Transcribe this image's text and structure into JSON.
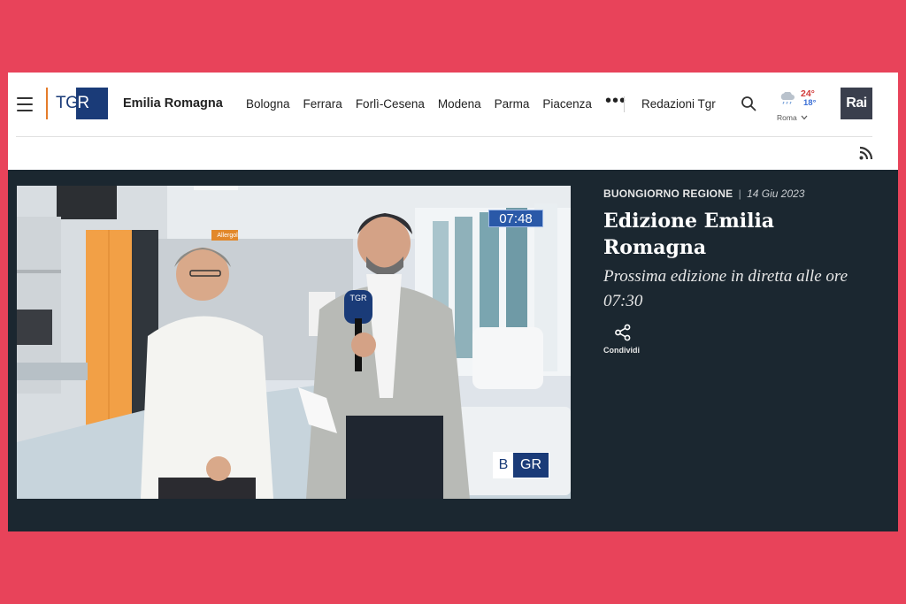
{
  "header": {
    "logo_t": "TG",
    "logo_r": "R",
    "region": "Emilia Romagna",
    "nav": [
      "Bologna",
      "Ferrara",
      "Forlì-Cesena",
      "Modena",
      "Parma",
      "Piacenza"
    ],
    "more": "•••",
    "redazioni": "Redazioni Tgr",
    "weather": {
      "max": "24°",
      "min": "18°",
      "city": "Roma"
    },
    "rai_logo": "Rai"
  },
  "video": {
    "time_overlay": "07:48",
    "mic_logo": "TGR",
    "bug_b": "B",
    "bug_gr": "GR",
    "sign": "Allergol"
  },
  "article": {
    "show": "BUONGIORNO REGIONE",
    "separator": "|",
    "date": "14 Giu 2023",
    "title": "Edizione Emilia Romagna",
    "subtitle": "Prossima edizione in diretta alle ore 07:30",
    "share_label": "Condividi"
  },
  "colors": {
    "background": "#e8435a",
    "dark_panel": "#1b2730",
    "tgr_blue": "#1a3b78",
    "temp_max": "#d13a3a",
    "temp_min": "#3b6fd6"
  },
  "icons": [
    "hamburger-menu-icon",
    "search-icon",
    "rain-cloud-icon",
    "chevron-down-icon",
    "rss-icon",
    "share-icon"
  ]
}
